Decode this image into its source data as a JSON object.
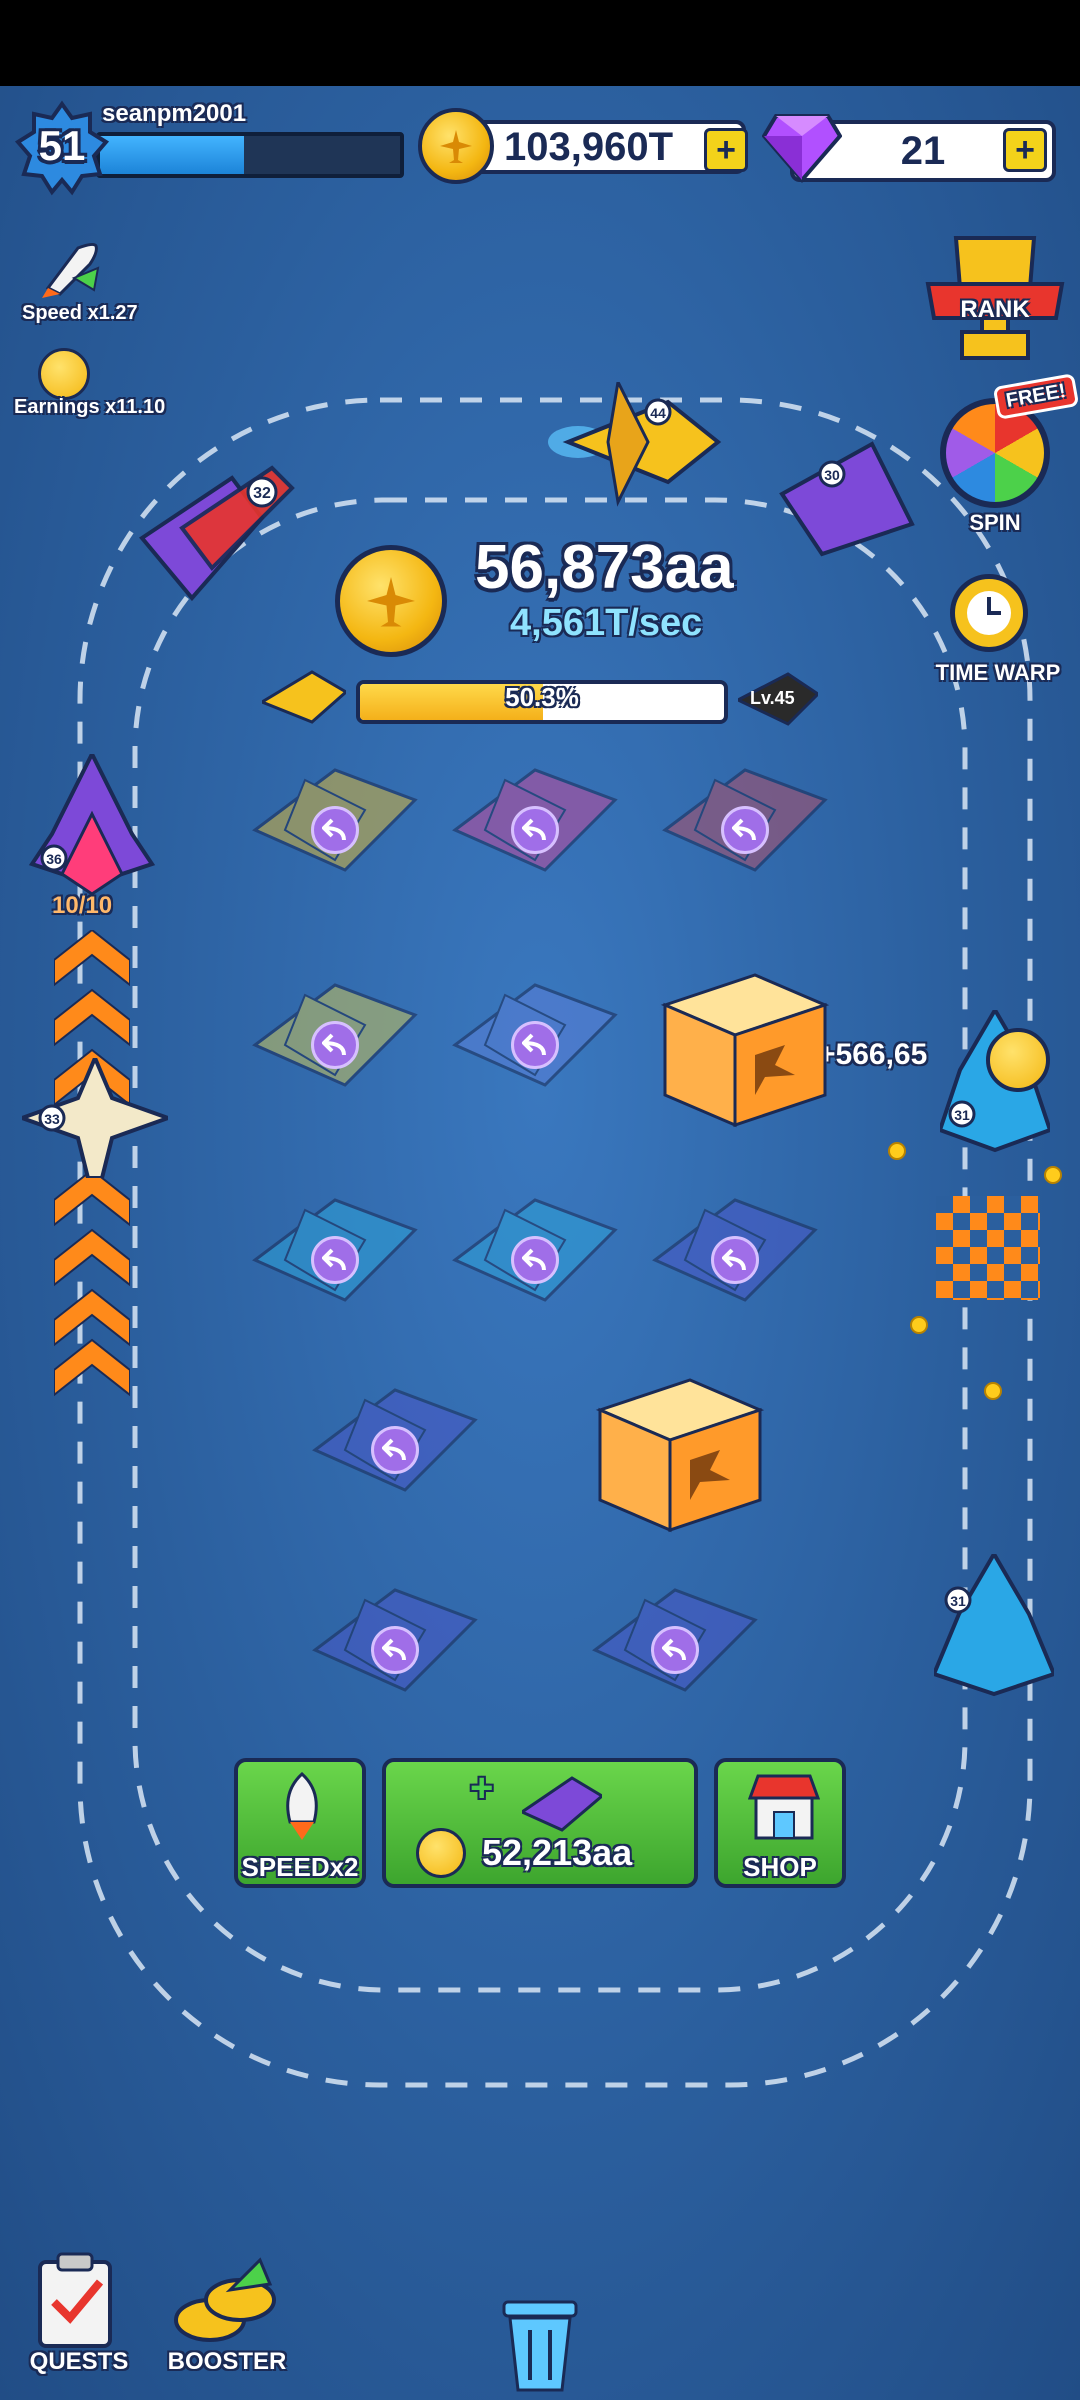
{
  "player": {
    "username": "seanpm2001",
    "level": "51",
    "xp_fraction": 0.48
  },
  "currency": {
    "coins": "103,960T",
    "gems": "21"
  },
  "boosts": {
    "speed_label": "Speed x1.27",
    "earnings_label": "Earnings x11.10"
  },
  "right_menu": {
    "rank_label": "RANK",
    "free_badge": "FREE!",
    "spin_label": "SPIN",
    "time_warp_label": "TIME WARP"
  },
  "center": {
    "total_coins": "56,873aa",
    "rate": "4,561T/sec",
    "progress_text": "50.3%",
    "progress_fraction": 0.503,
    "next_level": "Lv.45"
  },
  "grid": {
    "row1": [
      "plane-level-38",
      "plane-level-36",
      "plane-level-32"
    ],
    "row2": [
      "plane-level-34",
      "plane-level-33",
      "mystery-box"
    ],
    "row3": [
      "plane-level-31",
      "plane-level-31",
      "plane-level-30"
    ],
    "row4": [
      "plane-level-30",
      "mystery-box"
    ],
    "row5": [
      "plane-level-30",
      "plane-level-30"
    ]
  },
  "track_planes": {
    "plane_a_numbers": "32",
    "plane_b_numbers": "44",
    "plane_c_numbers": "30",
    "plane_d_numbers": "36",
    "plane_d_boost": "10/10",
    "plane_e_numbers": "33",
    "plane_f_numbers": "31",
    "plane_g_numbers": "31"
  },
  "floating_income": "+566,65",
  "bottom_actions": {
    "speed_label": "SPEEDx2",
    "buy_price": "52,213aa",
    "shop_label": "SHOP"
  },
  "footer": {
    "quests_label": "QUESTS",
    "booster_label": "BOOSTER"
  },
  "colors": {
    "background": "#2b5f9e",
    "accent_green": "#4cba37",
    "gold": "#f4b712",
    "outline": "#1a2a55"
  }
}
